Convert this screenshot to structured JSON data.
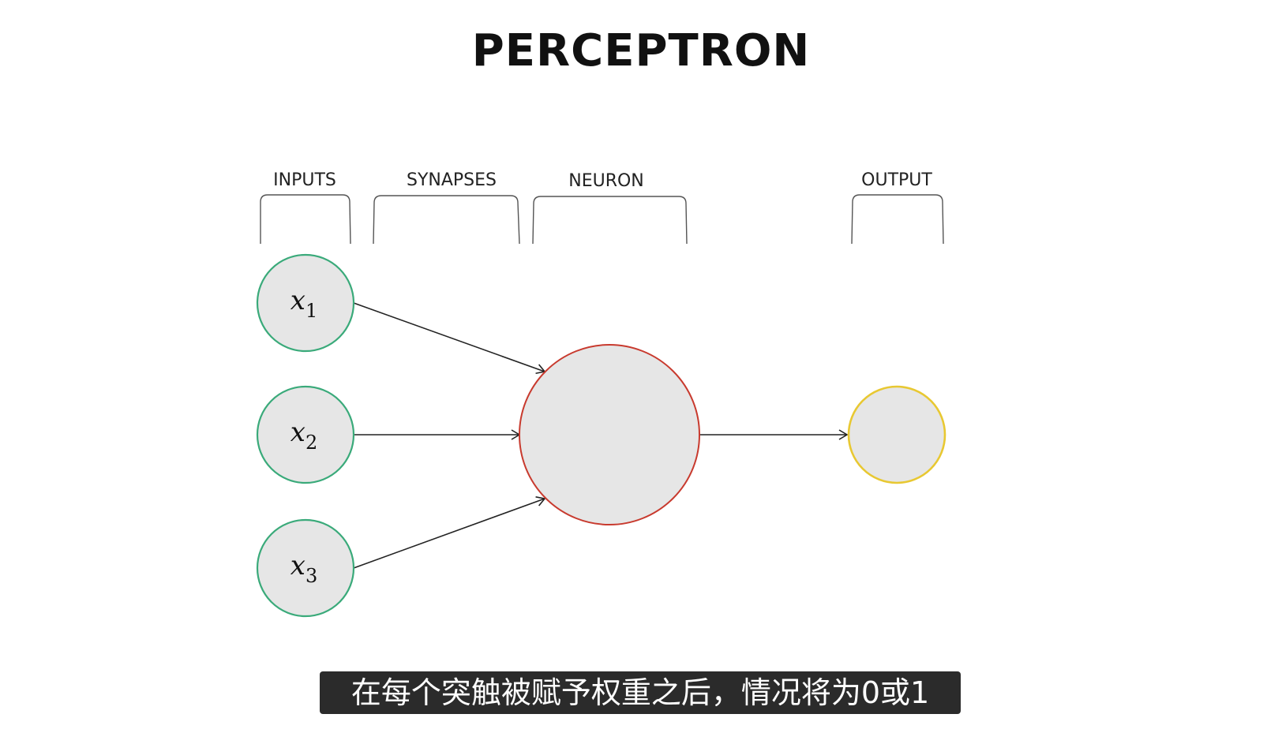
{
  "title": "PERCEPTRON",
  "sections": {
    "inputs": "INPUTS",
    "synapses": "SYNAPSES",
    "neuron": "NEURON",
    "output": "OUTPUT"
  },
  "inputs": [
    {
      "var": "x",
      "sub": "1"
    },
    {
      "var": "x",
      "sub": "2"
    },
    {
      "var": "x",
      "sub": "3"
    }
  ],
  "colors": {
    "input_stroke": "#3aaa7a",
    "neuron_stroke": "#c83a2e",
    "output_stroke": "#e8c832",
    "node_fill": "#e6e6e6",
    "arrow": "#222222"
  },
  "caption": "在每个突触被赋予权重之后，情况将为0或1"
}
